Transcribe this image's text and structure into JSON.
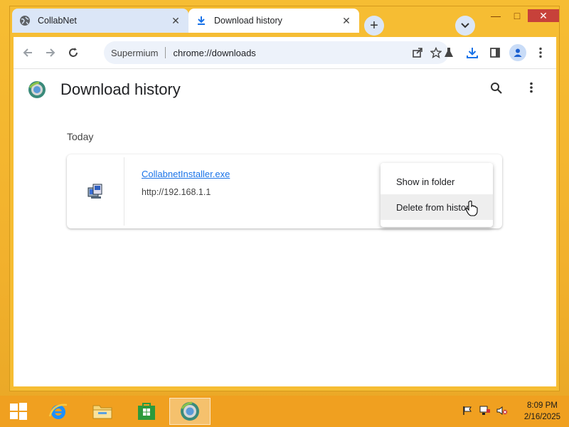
{
  "browser": {
    "tabs": [
      {
        "label": "CollabNet",
        "icon": "globe-icon"
      },
      {
        "label": "Download history",
        "icon": "download-icon"
      }
    ],
    "address_site": "Supermium",
    "address_url": "chrome://downloads"
  },
  "page": {
    "title": "Download history",
    "section": "Today",
    "download": {
      "filename": "CollabnetInstaller.exe",
      "source_url": "http://192.168.1.1"
    }
  },
  "context_menu": {
    "items": [
      "Show in folder",
      "Delete from history"
    ],
    "highlighted": 1
  },
  "taskbar": {
    "time": "8:09 PM",
    "date": "2/16/2025"
  },
  "colors": {
    "desktop": "#f2b12d",
    "taskbar": "#f0a020",
    "link": "#1a73e8",
    "tab_inactive": "#dbe6f7"
  }
}
